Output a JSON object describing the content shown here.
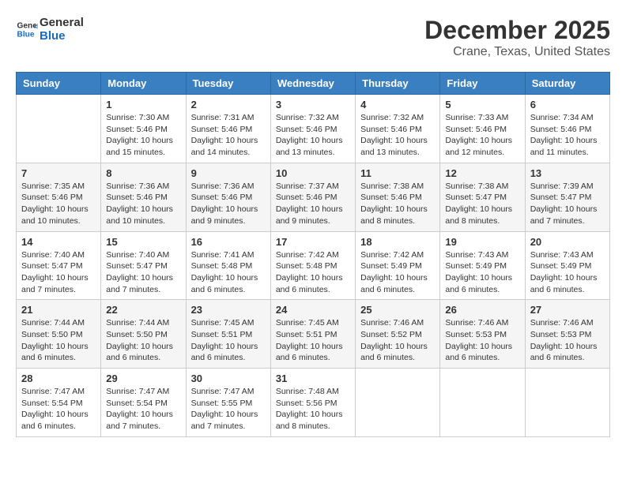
{
  "header": {
    "logo_line1": "General",
    "logo_line2": "Blue",
    "title": "December 2025",
    "subtitle": "Crane, Texas, United States"
  },
  "days_of_week": [
    "Sunday",
    "Monday",
    "Tuesday",
    "Wednesday",
    "Thursday",
    "Friday",
    "Saturday"
  ],
  "weeks": [
    [
      {
        "day": "",
        "info": ""
      },
      {
        "day": "1",
        "info": "Sunrise: 7:30 AM\nSunset: 5:46 PM\nDaylight: 10 hours\nand 15 minutes."
      },
      {
        "day": "2",
        "info": "Sunrise: 7:31 AM\nSunset: 5:46 PM\nDaylight: 10 hours\nand 14 minutes."
      },
      {
        "day": "3",
        "info": "Sunrise: 7:32 AM\nSunset: 5:46 PM\nDaylight: 10 hours\nand 13 minutes."
      },
      {
        "day": "4",
        "info": "Sunrise: 7:32 AM\nSunset: 5:46 PM\nDaylight: 10 hours\nand 13 minutes."
      },
      {
        "day": "5",
        "info": "Sunrise: 7:33 AM\nSunset: 5:46 PM\nDaylight: 10 hours\nand 12 minutes."
      },
      {
        "day": "6",
        "info": "Sunrise: 7:34 AM\nSunset: 5:46 PM\nDaylight: 10 hours\nand 11 minutes."
      }
    ],
    [
      {
        "day": "7",
        "info": "Sunrise: 7:35 AM\nSunset: 5:46 PM\nDaylight: 10 hours\nand 10 minutes."
      },
      {
        "day": "8",
        "info": "Sunrise: 7:36 AM\nSunset: 5:46 PM\nDaylight: 10 hours\nand 10 minutes."
      },
      {
        "day": "9",
        "info": "Sunrise: 7:36 AM\nSunset: 5:46 PM\nDaylight: 10 hours\nand 9 minutes."
      },
      {
        "day": "10",
        "info": "Sunrise: 7:37 AM\nSunset: 5:46 PM\nDaylight: 10 hours\nand 9 minutes."
      },
      {
        "day": "11",
        "info": "Sunrise: 7:38 AM\nSunset: 5:46 PM\nDaylight: 10 hours\nand 8 minutes."
      },
      {
        "day": "12",
        "info": "Sunrise: 7:38 AM\nSunset: 5:47 PM\nDaylight: 10 hours\nand 8 minutes."
      },
      {
        "day": "13",
        "info": "Sunrise: 7:39 AM\nSunset: 5:47 PM\nDaylight: 10 hours\nand 7 minutes."
      }
    ],
    [
      {
        "day": "14",
        "info": "Sunrise: 7:40 AM\nSunset: 5:47 PM\nDaylight: 10 hours\nand 7 minutes."
      },
      {
        "day": "15",
        "info": "Sunrise: 7:40 AM\nSunset: 5:47 PM\nDaylight: 10 hours\nand 7 minutes."
      },
      {
        "day": "16",
        "info": "Sunrise: 7:41 AM\nSunset: 5:48 PM\nDaylight: 10 hours\nand 6 minutes."
      },
      {
        "day": "17",
        "info": "Sunrise: 7:42 AM\nSunset: 5:48 PM\nDaylight: 10 hours\nand 6 minutes."
      },
      {
        "day": "18",
        "info": "Sunrise: 7:42 AM\nSunset: 5:49 PM\nDaylight: 10 hours\nand 6 minutes."
      },
      {
        "day": "19",
        "info": "Sunrise: 7:43 AM\nSunset: 5:49 PM\nDaylight: 10 hours\nand 6 minutes."
      },
      {
        "day": "20",
        "info": "Sunrise: 7:43 AM\nSunset: 5:49 PM\nDaylight: 10 hours\nand 6 minutes."
      }
    ],
    [
      {
        "day": "21",
        "info": "Sunrise: 7:44 AM\nSunset: 5:50 PM\nDaylight: 10 hours\nand 6 minutes."
      },
      {
        "day": "22",
        "info": "Sunrise: 7:44 AM\nSunset: 5:50 PM\nDaylight: 10 hours\nand 6 minutes."
      },
      {
        "day": "23",
        "info": "Sunrise: 7:45 AM\nSunset: 5:51 PM\nDaylight: 10 hours\nand 6 minutes."
      },
      {
        "day": "24",
        "info": "Sunrise: 7:45 AM\nSunset: 5:51 PM\nDaylight: 10 hours\nand 6 minutes."
      },
      {
        "day": "25",
        "info": "Sunrise: 7:46 AM\nSunset: 5:52 PM\nDaylight: 10 hours\nand 6 minutes."
      },
      {
        "day": "26",
        "info": "Sunrise: 7:46 AM\nSunset: 5:53 PM\nDaylight: 10 hours\nand 6 minutes."
      },
      {
        "day": "27",
        "info": "Sunrise: 7:46 AM\nSunset: 5:53 PM\nDaylight: 10 hours\nand 6 minutes."
      }
    ],
    [
      {
        "day": "28",
        "info": "Sunrise: 7:47 AM\nSunset: 5:54 PM\nDaylight: 10 hours\nand 6 minutes."
      },
      {
        "day": "29",
        "info": "Sunrise: 7:47 AM\nSunset: 5:54 PM\nDaylight: 10 hours\nand 7 minutes."
      },
      {
        "day": "30",
        "info": "Sunrise: 7:47 AM\nSunset: 5:55 PM\nDaylight: 10 hours\nand 7 minutes."
      },
      {
        "day": "31",
        "info": "Sunrise: 7:48 AM\nSunset: 5:56 PM\nDaylight: 10 hours\nand 8 minutes."
      },
      {
        "day": "",
        "info": ""
      },
      {
        "day": "",
        "info": ""
      },
      {
        "day": "",
        "info": ""
      }
    ]
  ]
}
